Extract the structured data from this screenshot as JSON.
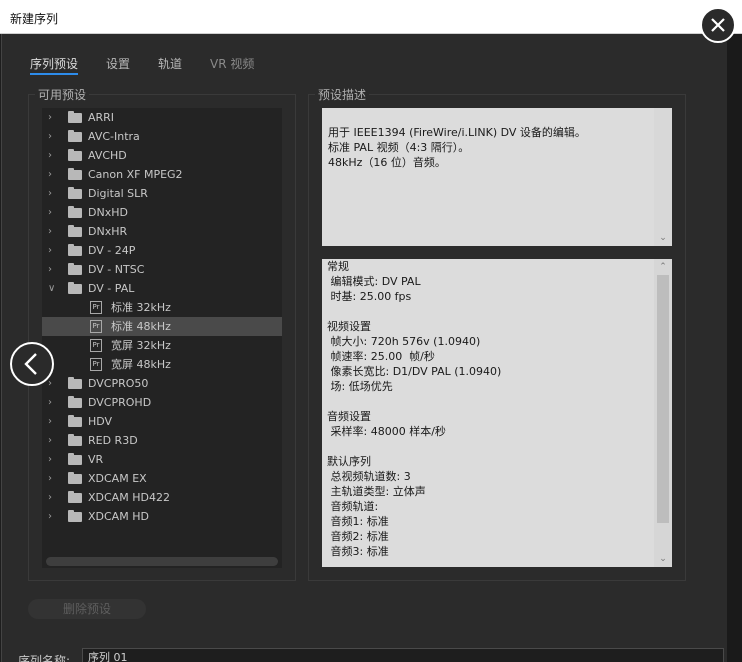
{
  "window": {
    "title": "新建序列"
  },
  "tabs": [
    {
      "label": "序列预设",
      "state": "active"
    },
    {
      "label": "设置",
      "state": "normal"
    },
    {
      "label": "轨道",
      "state": "normal"
    },
    {
      "label": "VR 视频",
      "state": "dim"
    }
  ],
  "presets": {
    "label": "可用预设",
    "folders": [
      {
        "label": "ARRI",
        "expanded": false
      },
      {
        "label": "AVC-Intra",
        "expanded": false
      },
      {
        "label": "AVCHD",
        "expanded": false
      },
      {
        "label": "Canon XF MPEG2",
        "expanded": false
      },
      {
        "label": "Digital SLR",
        "expanded": false
      },
      {
        "label": "DNxHD",
        "expanded": false
      },
      {
        "label": "DNxHR",
        "expanded": false
      },
      {
        "label": "DV - 24P",
        "expanded": false
      },
      {
        "label": "DV - NTSC",
        "expanded": false
      },
      {
        "label": "DV - PAL",
        "expanded": true
      },
      {
        "label": "DVCPRO50",
        "expanded": false
      },
      {
        "label": "DVCPROHD",
        "expanded": false
      },
      {
        "label": "HDV",
        "expanded": false
      },
      {
        "label": "RED R3D",
        "expanded": false
      },
      {
        "label": "VR",
        "expanded": false
      },
      {
        "label": "XDCAM EX",
        "expanded": false
      },
      {
        "label": "XDCAM HD422",
        "expanded": false
      },
      {
        "label": "XDCAM HD",
        "expanded": false
      }
    ],
    "dv_pal_children": [
      {
        "label": "标准 32kHz",
        "selected": false
      },
      {
        "label": "标准 48kHz",
        "selected": true
      },
      {
        "label": "宽屏 32kHz",
        "selected": false
      },
      {
        "label": "宽屏 48kHz",
        "selected": false
      }
    ],
    "pr_icon": "Pr"
  },
  "description": {
    "label": "预设描述",
    "text": "用于 IEEE1394 (FireWire/i.LINK) DV 设备的编辑。\n标准 PAL 视频（4:3 隔行）。\n48kHz（16 位）音频。"
  },
  "details": {
    "text": "常规\n 编辑模式: DV PAL\n 时基: 25.00 fps\n\n视频设置\n 帧大小: 720h 576v (1.0940)\n 帧速率: 25.00  帧/秒\n 像素长宽比: D1/DV PAL (1.0940)\n 场: 低场优先\n\n音频设置\n 采样率: 48000 样本/秒\n\n默认序列\n 总视频轨道数: 3\n 主轨道类型: 立体声\n 音频轨道:\n 音频1: 标准\n 音频2: 标准\n 音频3: 标准"
  },
  "buttons": {
    "delete_preset": "删除预设"
  },
  "sequence_name": {
    "label": "序列名称:",
    "value": "序列 01"
  },
  "icons": {
    "close": "close-icon",
    "back": "chevron-left-icon",
    "folder": "folder-icon",
    "expand": "chevron-right-icon"
  }
}
